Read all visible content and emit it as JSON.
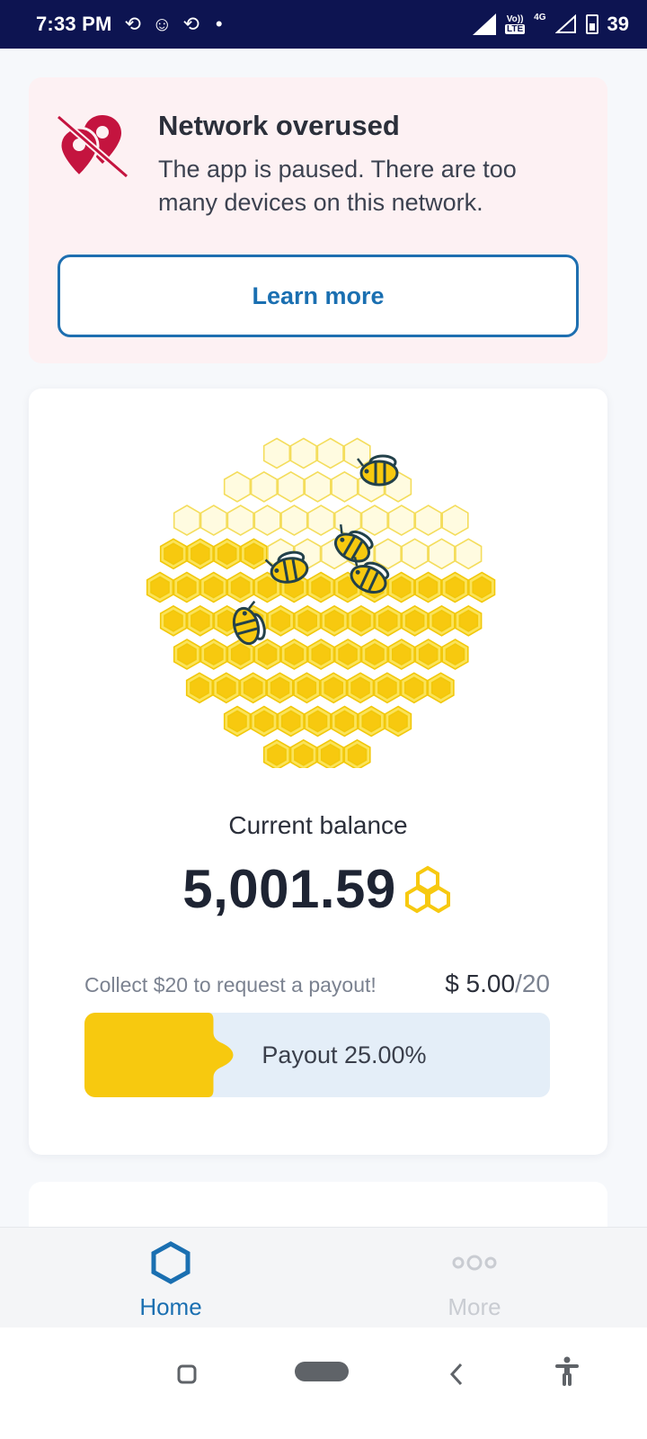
{
  "status_bar": {
    "time": "7:33 PM",
    "battery_level": "39",
    "network_label": "4G",
    "lte_top": "Vo))",
    "lte_bottom": "LTE"
  },
  "alert": {
    "title": "Network overused",
    "message": "The app is paused. There are too many devices on this network.",
    "button_label": "Learn more",
    "icon": "location-off-icon"
  },
  "balance": {
    "label": "Current balance",
    "value": "5,001.59",
    "currency_icon": "honeycomb-icon"
  },
  "payout": {
    "hint": "Collect $20 to request a payout!",
    "current": "$ 5.00",
    "separator": "/",
    "goal": "20",
    "progress_label": "Payout 25.00%",
    "progress_fraction": 0.25
  },
  "bottom_nav": {
    "items": [
      {
        "label": "Home",
        "icon": "hexagon-icon",
        "active": true
      },
      {
        "label": "More",
        "icon": "more-dots-icon",
        "active": false
      }
    ]
  },
  "colors": {
    "accent": "#1a6fb1",
    "honey": "#f7c90f",
    "alert_icon": "#c4143f",
    "status_bar": "#0d1451"
  }
}
